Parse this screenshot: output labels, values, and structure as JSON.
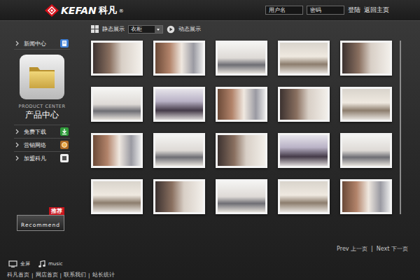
{
  "header": {
    "logo": {
      "brand": "KEFAN",
      "name": "科凡",
      "mark": "®"
    },
    "login": {
      "username_placeholder": "用户名",
      "password_placeholder": "密码",
      "login_link": "登陆",
      "home_link": "返回主页"
    }
  },
  "sidebar": {
    "top_item": {
      "label": "新闻中心",
      "kind": "news"
    },
    "product": {
      "title_en": "PRODUCT CENTER",
      "title": "产品中心"
    },
    "items": [
      {
        "label": "免费下载",
        "kind": "download"
      },
      {
        "label": "营销网络",
        "kind": "network"
      },
      {
        "label": "加盟科凡",
        "kind": "join"
      }
    ],
    "recommend": {
      "label": "Recommend",
      "badge": "推荐"
    }
  },
  "toolbar": {
    "static_label": "静态展示",
    "dropdown_value": "衣柜",
    "dynamic_label": "动态展示"
  },
  "gallery": {
    "thumbnails": [
      {},
      {},
      {},
      {},
      {},
      {},
      {},
      {},
      {},
      {},
      {},
      {},
      {},
      {},
      {},
      {},
      {},
      {},
      {},
      {}
    ]
  },
  "pager": {
    "prev": "Prev 上一页",
    "separator": "|",
    "next": "Next 下一页"
  },
  "tools": [
    {
      "label": "全屏",
      "kind": "fullscreen"
    },
    {
      "label": "music",
      "kind": "music"
    }
  ],
  "footer": {
    "links": [
      "科凡首页",
      "网店首页",
      "联系我们",
      "站长统计"
    ],
    "separator": "|"
  }
}
